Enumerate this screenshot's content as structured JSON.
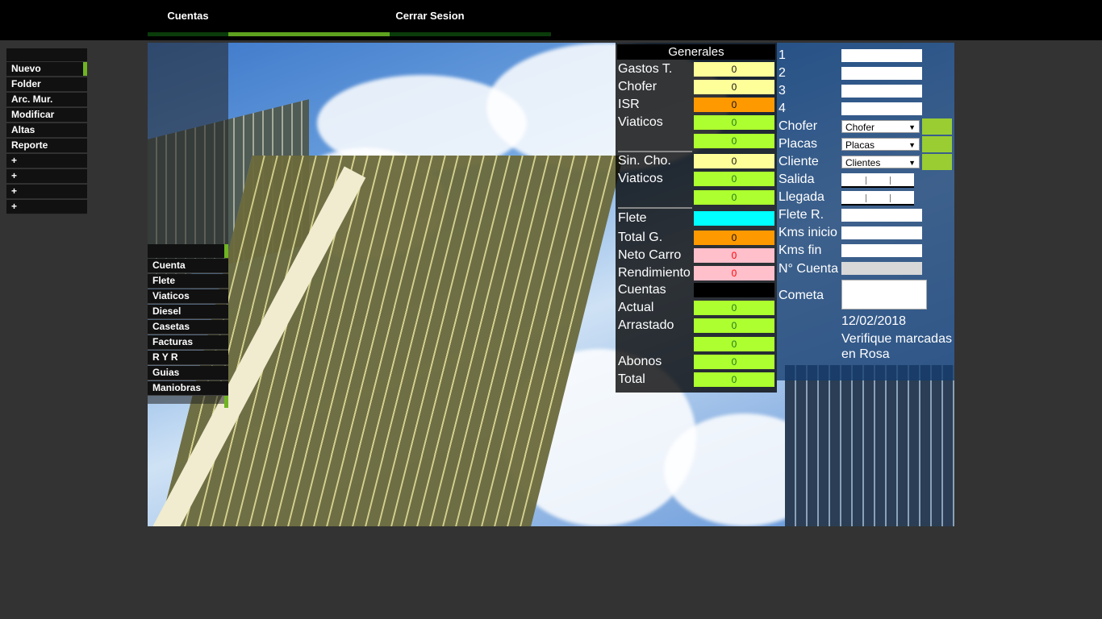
{
  "topnav": {
    "tab1": "Cuentas",
    "tab2": "Cerrar Sesion"
  },
  "leftmenu": {
    "items": [
      "Nuevo",
      "Folder",
      "Arc. Mur.",
      "Modificar",
      "Altas",
      "Reporte",
      "+",
      "+",
      "+",
      "+"
    ]
  },
  "submenu": {
    "items": [
      "Cuenta",
      "Flete",
      "Viaticos",
      "Diesel",
      "Casetas",
      "Facturas",
      "R Y R",
      "Guias",
      "Maniobras"
    ]
  },
  "generales": {
    "title": "Generales",
    "rows": {
      "gastos": {
        "label": "Gastos T.",
        "value": "0"
      },
      "chofer": {
        "label": "Chofer",
        "value": "0"
      },
      "isr": {
        "label": "ISR",
        "value": "0"
      },
      "viaticos": {
        "label": "Viaticos",
        "value": "0"
      },
      "viaticos2": {
        "value": "0"
      },
      "sincho": {
        "label": "Sin. Cho.",
        "value": "0"
      },
      "viaticos3": {
        "label": "Viaticos",
        "value": "0"
      },
      "viaticos4": {
        "value": "0"
      },
      "flete": {
        "label": "Flete",
        "value": ""
      },
      "totalg": {
        "label": "Total G.",
        "value": "0"
      },
      "neto": {
        "label": "Neto Carro",
        "value": "0"
      },
      "rend": {
        "label": "Rendimiento",
        "value": "0"
      },
      "cuentas": {
        "label": "Cuentas",
        "value": ""
      },
      "actual": {
        "label": "Actual",
        "value": "0"
      },
      "arrastado": {
        "label": "Arrastado",
        "value": "0"
      },
      "arrastado2": {
        "value": "0"
      },
      "abonos": {
        "label": "Abonos",
        "value": "0"
      },
      "total": {
        "label": "Total",
        "value": "0"
      }
    }
  },
  "form": {
    "n1": "1",
    "n2": "2",
    "n3": "3",
    "n4": "4",
    "chofer_label": "Chofer",
    "chofer_value": "Chofer",
    "placas_label": "Placas",
    "placas_value": "Placas",
    "cliente_label": "Cliente",
    "cliente_value": "Clientes",
    "salida_label": "Salida",
    "llegada_label": "Llegada",
    "flete_label": "Flete R.",
    "kms_inicio_label": "Kms inicio",
    "kms_fin_label": "Kms fin",
    "cuenta_label": "N° Cuenta",
    "cometa_label": "Cometa",
    "date": "12/02/2018",
    "note": "Verifique marcadas en Rosa"
  },
  "colors": {
    "accent_green": "#6fb522",
    "pink_warn": "#ffbfcb",
    "green_ok": "#adff2f",
    "orange": "#ff9900",
    "yellow": "#ffff99",
    "cyan": "#00ffff"
  }
}
